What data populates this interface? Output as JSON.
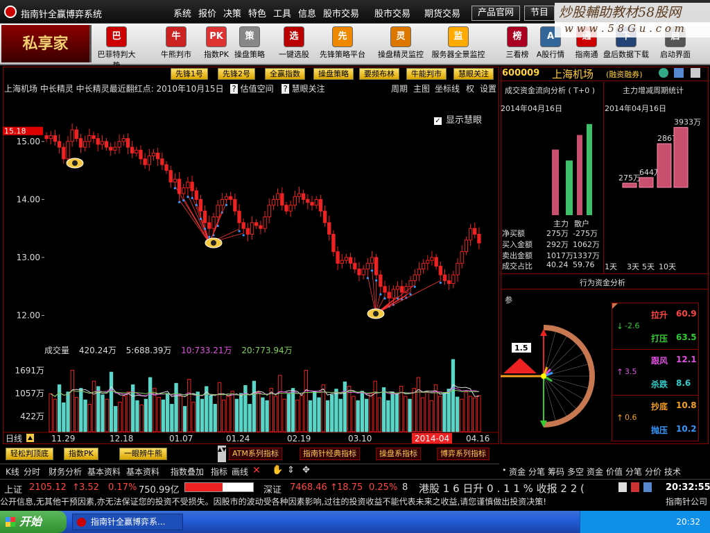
{
  "titlebar": {
    "app_title": "指南针全赢博弈系统",
    "menus": [
      "系统",
      "报价",
      "决策",
      "特色",
      "工具",
      "信息",
      "股市交易",
      "股市交易",
      "期货交易"
    ],
    "buttons": [
      "产品官网",
      "节目"
    ],
    "watermark": "炒股輔助教材58股网",
    "watermark_url": "w w w . 5 8 G u . c o m"
  },
  "toolbar": {
    "brand": "私享家",
    "tools": [
      {
        "label": "巴菲特判大势",
        "icon": "巴",
        "color": "#c00"
      },
      {
        "label": "牛熊判市",
        "icon": "牛",
        "color": "#c22"
      },
      {
        "label": "指数PK",
        "icon": "PK",
        "color": "#d33"
      },
      {
        "label": "操盘策略",
        "icon": "策",
        "color": "#888"
      },
      {
        "label": "一键选股",
        "icon": "选",
        "color": "#b00"
      },
      {
        "label": "先锋策略平台",
        "icon": "先",
        "color": "#e80"
      },
      {
        "label": "操盘精灵监控",
        "icon": "灵",
        "color": "#d70"
      },
      {
        "label": "服务器全景监控",
        "icon": "监",
        "color": "#fa0"
      },
      {
        "label": "三看榜",
        "icon": "榜",
        "color": "#a02"
      },
      {
        "label": "A股行情",
        "icon": "A",
        "color": "#369"
      },
      {
        "label": "指南通",
        "icon": "通",
        "color": "#c00"
      },
      {
        "label": "盘后数据下载",
        "icon": "下",
        "color": "#247"
      },
      {
        "label": "启动界面",
        "icon": "启",
        "color": "#555"
      }
    ]
  },
  "chart_tabs": [
    "先锋1号",
    "先锋2号",
    "全赢指数",
    "操盘策略",
    "要频布林",
    "牛能判市",
    "慧眼关注"
  ],
  "chart_header": {
    "title": "上海机场 中长精灵 中长精灵最近翻红点: 2010年10月15日",
    "valuation": "估值空间",
    "focus": "慧眼关注",
    "right_items": [
      "周期",
      "主图",
      "坐标线",
      "权",
      "设置"
    ],
    "show_eye": "显示慧眼",
    "price_marker": "15.18"
  },
  "chart_data": [
    {
      "type": "candlestick",
      "title": "上海机场",
      "ylim": [
        11.6,
        15.5
      ],
      "yticks": [
        12.0,
        13.0,
        14.0,
        15.0
      ],
      "xticks": [
        "11.29",
        "12.18",
        "01.07",
        "01.24",
        "02.19",
        "03.10",
        "2014-04",
        "04.16"
      ],
      "closes": [
        15.05,
        15.1,
        15.0,
        14.9,
        14.7,
        15.0,
        15.2,
        15.05,
        14.9,
        15.0,
        15.1,
        15.05,
        14.95,
        15.0,
        14.9,
        14.85,
        14.9,
        15.0,
        15.05,
        14.9,
        14.8,
        14.85,
        14.7,
        14.6,
        14.75,
        14.8,
        14.7,
        14.6,
        14.5,
        14.3,
        14.35,
        14.1,
        14.2,
        14.3,
        14.15,
        14.0,
        13.8,
        13.6,
        13.5,
        13.7,
        13.9,
        14.0,
        14.05,
        14.0,
        13.8,
        13.6,
        13.5,
        13.4,
        13.6,
        13.55,
        13.5,
        13.7,
        13.9,
        14.0,
        14.1,
        13.9,
        13.8,
        13.9,
        14.05,
        14.1,
        14.0,
        13.95,
        13.9,
        14.0,
        13.8,
        13.6,
        13.4,
        13.1,
        12.9,
        12.95,
        13.0,
        12.9,
        12.8,
        12.7,
        12.8,
        12.9,
        13.0,
        12.7,
        12.5,
        12.4,
        12.3,
        12.45,
        12.5,
        12.4,
        12.5,
        12.6,
        12.7,
        12.8,
        12.9,
        12.95,
        13.0,
        12.85,
        12.7,
        12.6,
        12.55,
        12.7,
        12.9,
        13.1,
        13.3,
        13.5,
        13.4,
        13.25
      ]
    },
    {
      "type": "bar",
      "title": "成交量",
      "ylim": [
        0,
        2000
      ],
      "yticks": [
        422,
        1057,
        1691
      ],
      "ytick_labels": [
        "422万",
        "1057万",
        "1691万"
      ],
      "values": [
        1050,
        900,
        1300,
        800,
        1100,
        1700,
        950,
        1200,
        880,
        760,
        1400,
        1250,
        1020,
        900,
        1650,
        700,
        820,
        980,
        1100,
        1300,
        860,
        740,
        900,
        1500,
        1200,
        950,
        880,
        1060,
        760,
        1340,
        980,
        700,
        1450,
        820,
        1100,
        900,
        1250,
        1000,
        760,
        1360,
        880,
        980,
        1120,
        900,
        1060,
        1280,
        760,
        1400,
        1100,
        940,
        860,
        1200,
        980,
        1560,
        900,
        1040,
        1200,
        880,
        1000,
        1700,
        860,
        1120,
        940,
        1300,
        860,
        1020,
        1180,
        900,
        1380,
        1260,
        980,
        860,
        1120,
        900,
        1060,
        1400,
        940,
        1220,
        860,
        1100,
        1040,
        1260,
        980,
        900,
        1200,
        1500,
        940,
        1100,
        860,
        1300,
        980,
        1060,
        1180,
        2000,
        960,
        900,
        1100,
        980,
        940,
        1000
      ],
      "ma_labels": {
        "label": "成交量",
        "val": "420.24万",
        "ma5": "5:688.39万",
        "ma10": "10:733.21万",
        "ma20": "20:773.94万"
      }
    }
  ],
  "eye_markers": [
    "top-left",
    "mid",
    "trough-1",
    "trough-2"
  ],
  "period": "日线",
  "right_panel": {
    "code": "600009",
    "name": "上海机场",
    "tag": "(融资融券)",
    "flow_title": "成交资金流向分析 ( T+0 )",
    "flow_date": "2014年04月16日",
    "flow_legend": [
      "主力",
      "散户"
    ],
    "flow_table": [
      {
        "label": "净买额",
        "main": "275万",
        "retail": "-275万"
      },
      {
        "label": "买入金额",
        "main": "292万",
        "retail": "1062万"
      },
      {
        "label": "卖出金额",
        "main": "1017万",
        "retail": "1337万"
      },
      {
        "label": "成交占比",
        "main": "40.24",
        "retail": "59.76"
      }
    ],
    "flow_bars": {
      "main": [
        9,
        7.5,
        0,
        0
      ],
      "retail": [
        0,
        0,
        11,
        12.5
      ]
    },
    "inc_title": "主力增减周期统计",
    "inc_date": "2014年04月16日",
    "inc_values": [
      275,
      644,
      2867,
      3933
    ],
    "inc_labels": [
      "275万",
      "644万",
      "2867万",
      "3933万"
    ],
    "inc_periods": [
      "1天",
      "3天",
      "5天",
      "10天"
    ],
    "behavior_title": "行为资金分析",
    "behavior_corner": "参",
    "behavior_value": "1.5",
    "behavior_table": [
      {
        "arrow": "down",
        "val": "-2.6",
        "items": [
          {
            "k": "拉升",
            "v": "60.9"
          },
          {
            "k": "打压",
            "v": "63.5"
          }
        ]
      },
      {
        "arrow": "up",
        "val": "3.5",
        "items": [
          {
            "k": "跟风",
            "v": "12.1"
          },
          {
            "k": "杀跌",
            "v": "8.6"
          }
        ]
      },
      {
        "arrow": "up",
        "val": "0.6",
        "items": [
          {
            "k": "抄底",
            "v": "10.8"
          },
          {
            "k": "抛压",
            "v": "10.2"
          }
        ]
      }
    ]
  },
  "buttons_row": {
    "left": [
      "轻松判顶底",
      "指数PK",
      "一眼辨牛熊"
    ],
    "indicators": [
      "ATM系列指标",
      "指南针经典指标",
      "操盘系指标",
      "博弈系列指标"
    ]
  },
  "bottom_tabs": [
    "K线",
    "分时",
    "财务分析",
    "基本资料",
    "基本资料",
    "指数叠加",
    "指标",
    "画线"
  ],
  "right_tabs": [
    "资金",
    "分笔",
    "筹码",
    "多空",
    "资金",
    "价值",
    "分笔",
    "分价",
    "技术"
  ],
  "ticker": {
    "sh_label": "上证",
    "sh_value": "2105.12",
    "sh_change": "3.52",
    "sh_pct": "0.17%",
    "sh_amount": "750.99亿",
    "sz_label": "深证",
    "sz_value": "7468.46",
    "sz_change": "18.75",
    "sz_pct": "0.25%",
    "sz_amount": "8",
    "hk": "港股 1 6 日升 0 . 1 1 % 收报 2 2 (",
    "time": "20:32:55"
  },
  "disclaimer": "公开信息,无其他干预因素,亦无法保证您的投资不受损失。因股市的波动受各种因素影响,过往的投资收益不能代表未来之收益,请您谨慎做出投资决策!",
  "disclaimer_right": "指南针公司",
  "taskbar": {
    "start": "开始",
    "task": "指南针全赢博弈系...",
    "clock": "20:32"
  }
}
